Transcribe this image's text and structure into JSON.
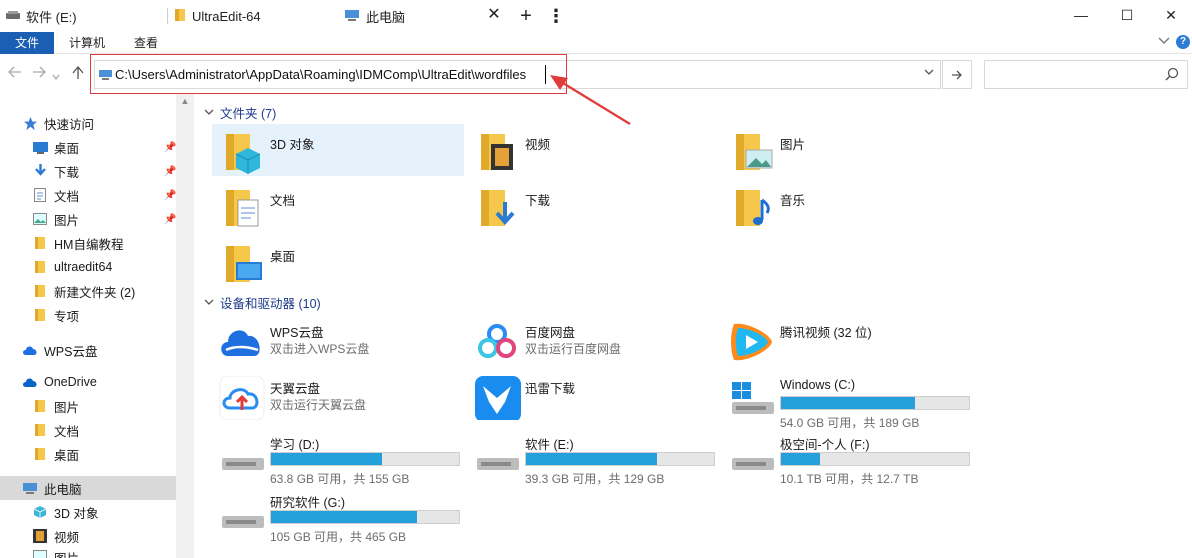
{
  "tabs": [
    {
      "label": "软件 (E:)",
      "icon": "drive-icon"
    },
    {
      "label": "UltraEdit-64",
      "icon": "folder-icon"
    },
    {
      "label": "此电脑",
      "icon": "this-pc-icon",
      "active": true
    }
  ],
  "window": {
    "new_tab": "+",
    "menu": "⋮",
    "minimize": "—",
    "maximize": "☐",
    "close": "✕",
    "tab_close": "✕"
  },
  "ribbon": {
    "file": "文件",
    "computer": "计算机",
    "view": "查看"
  },
  "nav": {
    "address": "C:\\Users\\Administrator\\AppData\\Roaming\\IDMComp\\UltraEdit\\wordfiles",
    "search_placeholder": ""
  },
  "sidebar": {
    "quick_access": "快速访问",
    "quick_items": [
      {
        "label": "桌面",
        "pinned": true
      },
      {
        "label": "下载",
        "pinned": true
      },
      {
        "label": "文档",
        "pinned": true
      },
      {
        "label": "图片",
        "pinned": true
      },
      {
        "label": "HM自编教程",
        "pinned": false
      },
      {
        "label": "ultraedit64",
        "pinned": false
      },
      {
        "label": "新建文件夹 (2)",
        "pinned": false
      },
      {
        "label": "专项",
        "pinned": false
      }
    ],
    "wps": "WPS云盘",
    "onedrive": "OneDrive",
    "onedrive_items": [
      "图片",
      "文档",
      "桌面"
    ],
    "this_pc": "此电脑",
    "pc_items": [
      "3D 对象",
      "视频",
      "图片"
    ]
  },
  "content": {
    "folders_header": "文件夹 (7)",
    "folders": [
      "3D 对象",
      "视频",
      "图片",
      "文档",
      "下载",
      "音乐",
      "桌面"
    ],
    "devices_header": "设备和驱动器 (10)",
    "apps": [
      {
        "name": "WPS云盘",
        "sub": "双击进入WPS云盘"
      },
      {
        "name": "百度网盘",
        "sub": "双击运行百度网盘"
      },
      {
        "name": "腾讯视频 (32 位)",
        "sub": ""
      },
      {
        "name": "天翼云盘",
        "sub": "双击运行天翼云盘"
      },
      {
        "name": "迅雷下载",
        "sub": ""
      }
    ],
    "drives": [
      {
        "name": "Windows (C:)",
        "free": "54.0 GB 可用，共 189 GB",
        "used_fraction": 0.714
      },
      {
        "name": "学习 (D:)",
        "free": "63.8 GB 可用，共 155 GB",
        "used_fraction": 0.588
      },
      {
        "name": "软件 (E:)",
        "free": "39.3 GB 可用，共 129 GB",
        "used_fraction": 0.695
      },
      {
        "name": "极空间-个人 (F:)",
        "free": "10.1 TB 可用，共 12.7 TB",
        "used_fraction": 0.205
      },
      {
        "name": "研究软件 (G:)",
        "free": "105 GB 可用，共 465 GB",
        "used_fraction": 0.774
      }
    ]
  }
}
